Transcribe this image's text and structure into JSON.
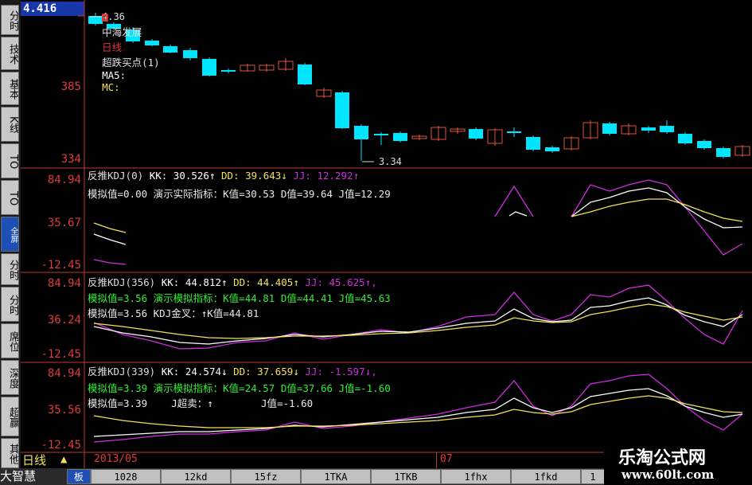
{
  "current_price": "4.416",
  "stock_name": "中海发展",
  "period": "日线",
  "indicator_name": "超跌买点(1)",
  "ma_label": "MA5:",
  "mc_label": "MC:",
  "high_mark": "4.36",
  "low_mark": "3.34",
  "price_axis": [
    "385",
    "334"
  ],
  "sidebar_tabs": [
    {
      "label": "分时",
      "active": false
    },
    {
      "label": "技术",
      "active": false
    },
    {
      "label": "基本",
      "active": false
    },
    {
      "label": "K线",
      "active": false
    },
    {
      "label": "TO",
      "active": false
    },
    {
      "label": "TO",
      "active": false
    },
    {
      "label": "全屏",
      "active": true
    },
    {
      "label": "分时",
      "active": false
    },
    {
      "label": "分时",
      "active": false
    },
    {
      "label": "席位",
      "active": false
    },
    {
      "label": "深度",
      "active": false
    },
    {
      "label": "超赢",
      "active": false
    },
    {
      "label": "其他",
      "active": false
    }
  ],
  "panels": [
    {
      "axis": [
        "84.94",
        "35.67",
        "-12.45"
      ],
      "line1": {
        "name": "反推KDJ(0)",
        "kk": "KK: 30.526↑",
        "dd": "DD: 39.643↓",
        "jj": "JJ: 12.292↑"
      },
      "line2": "模拟值=0.00 演示实际指标：K值=30.53 D值=39.64 J值=12.29",
      "line3": ""
    },
    {
      "axis": [
        "84.94",
        "36.24",
        "-12.45"
      ],
      "line1": {
        "name": "反推KDJ(356)",
        "kk": "KK: 44.812↑",
        "dd": "DD: 44.405↑",
        "jj": "JJ: 45.625↑,"
      },
      "line2": "模拟值=3.56 演示模拟指标：K值=44.81 D值=44.41 J值=45.63",
      "line3": "模拟值=3.56 KDJ金叉：↑K值=44.81"
    },
    {
      "axis": [
        "84.94",
        "35.56",
        "-12.45"
      ],
      "line1": {
        "name": "反推KDJ(339)",
        "kk": "KK: 24.574↓",
        "dd": "DD: 37.659↓",
        "jj": "JJ: -1.597↓,"
      },
      "line2": "模拟值=3.39 演示模拟指标：K值=24.57 D值=37.66 J值=-1.60",
      "line3": "模拟值=3.39    J超卖：↑        J值=-1.60"
    }
  ],
  "date_labels": [
    "2013/05",
    "07"
  ],
  "day_label": "日线",
  "brand": "大智慧",
  "bottom_tabs": [
    "板",
    "1028",
    "12kd",
    "15fz",
    "1TKA",
    "1TKB",
    "1fhx",
    "1fkd",
    "1"
  ],
  "watermark_title": "乐淘公式网",
  "watermark_url": "www.60lt.com",
  "colors": {
    "up": "#e0553a",
    "down": "#00e5ff",
    "k": "#ffffff",
    "d": "#f2e25a",
    "j": "#d02ce0",
    "axis": "#c0392b"
  }
}
